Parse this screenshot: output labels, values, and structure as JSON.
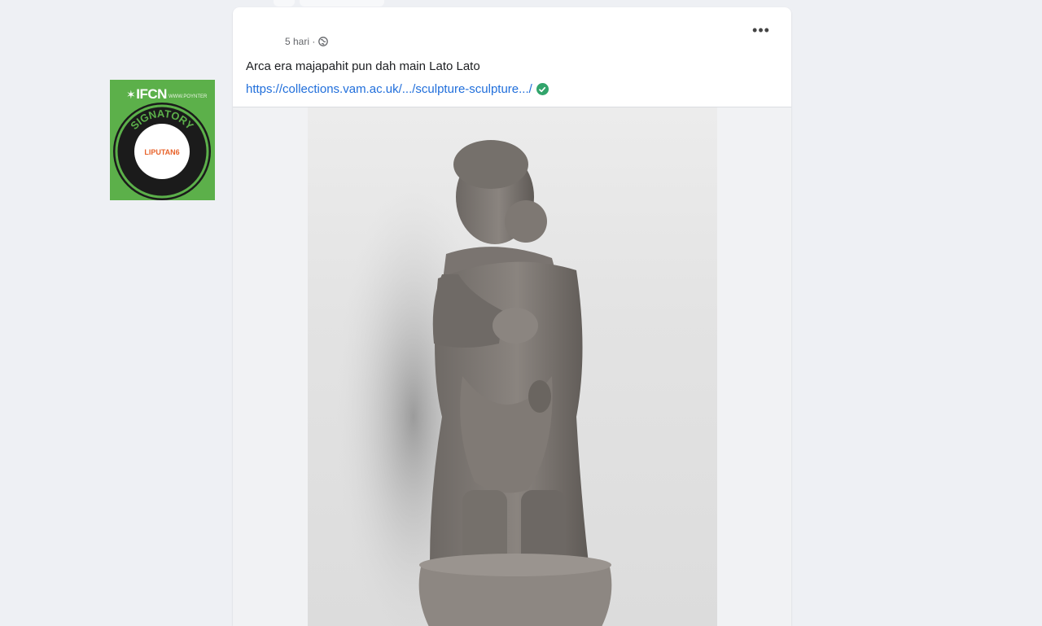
{
  "badge": {
    "logo_text": "IFCN",
    "small_text": "WWW.POYNTER",
    "ring_text": "SIGNATORY",
    "center_text": "LIPUTAN6"
  },
  "post": {
    "time_text": "5 hari ·",
    "caption": "Arca era majapahit pun dah main Lato Lato",
    "link_text": "https://collections.vam.ac.uk/.../sculpture-sculpture.../",
    "more_label": "•••"
  },
  "icons": {
    "globe": "globe-icon",
    "more": "more-icon",
    "verified": "check-circle-icon"
  },
  "colors": {
    "brand_green": "#5cb04a",
    "link_blue": "#216fdb",
    "verified_green": "#31a46b"
  }
}
